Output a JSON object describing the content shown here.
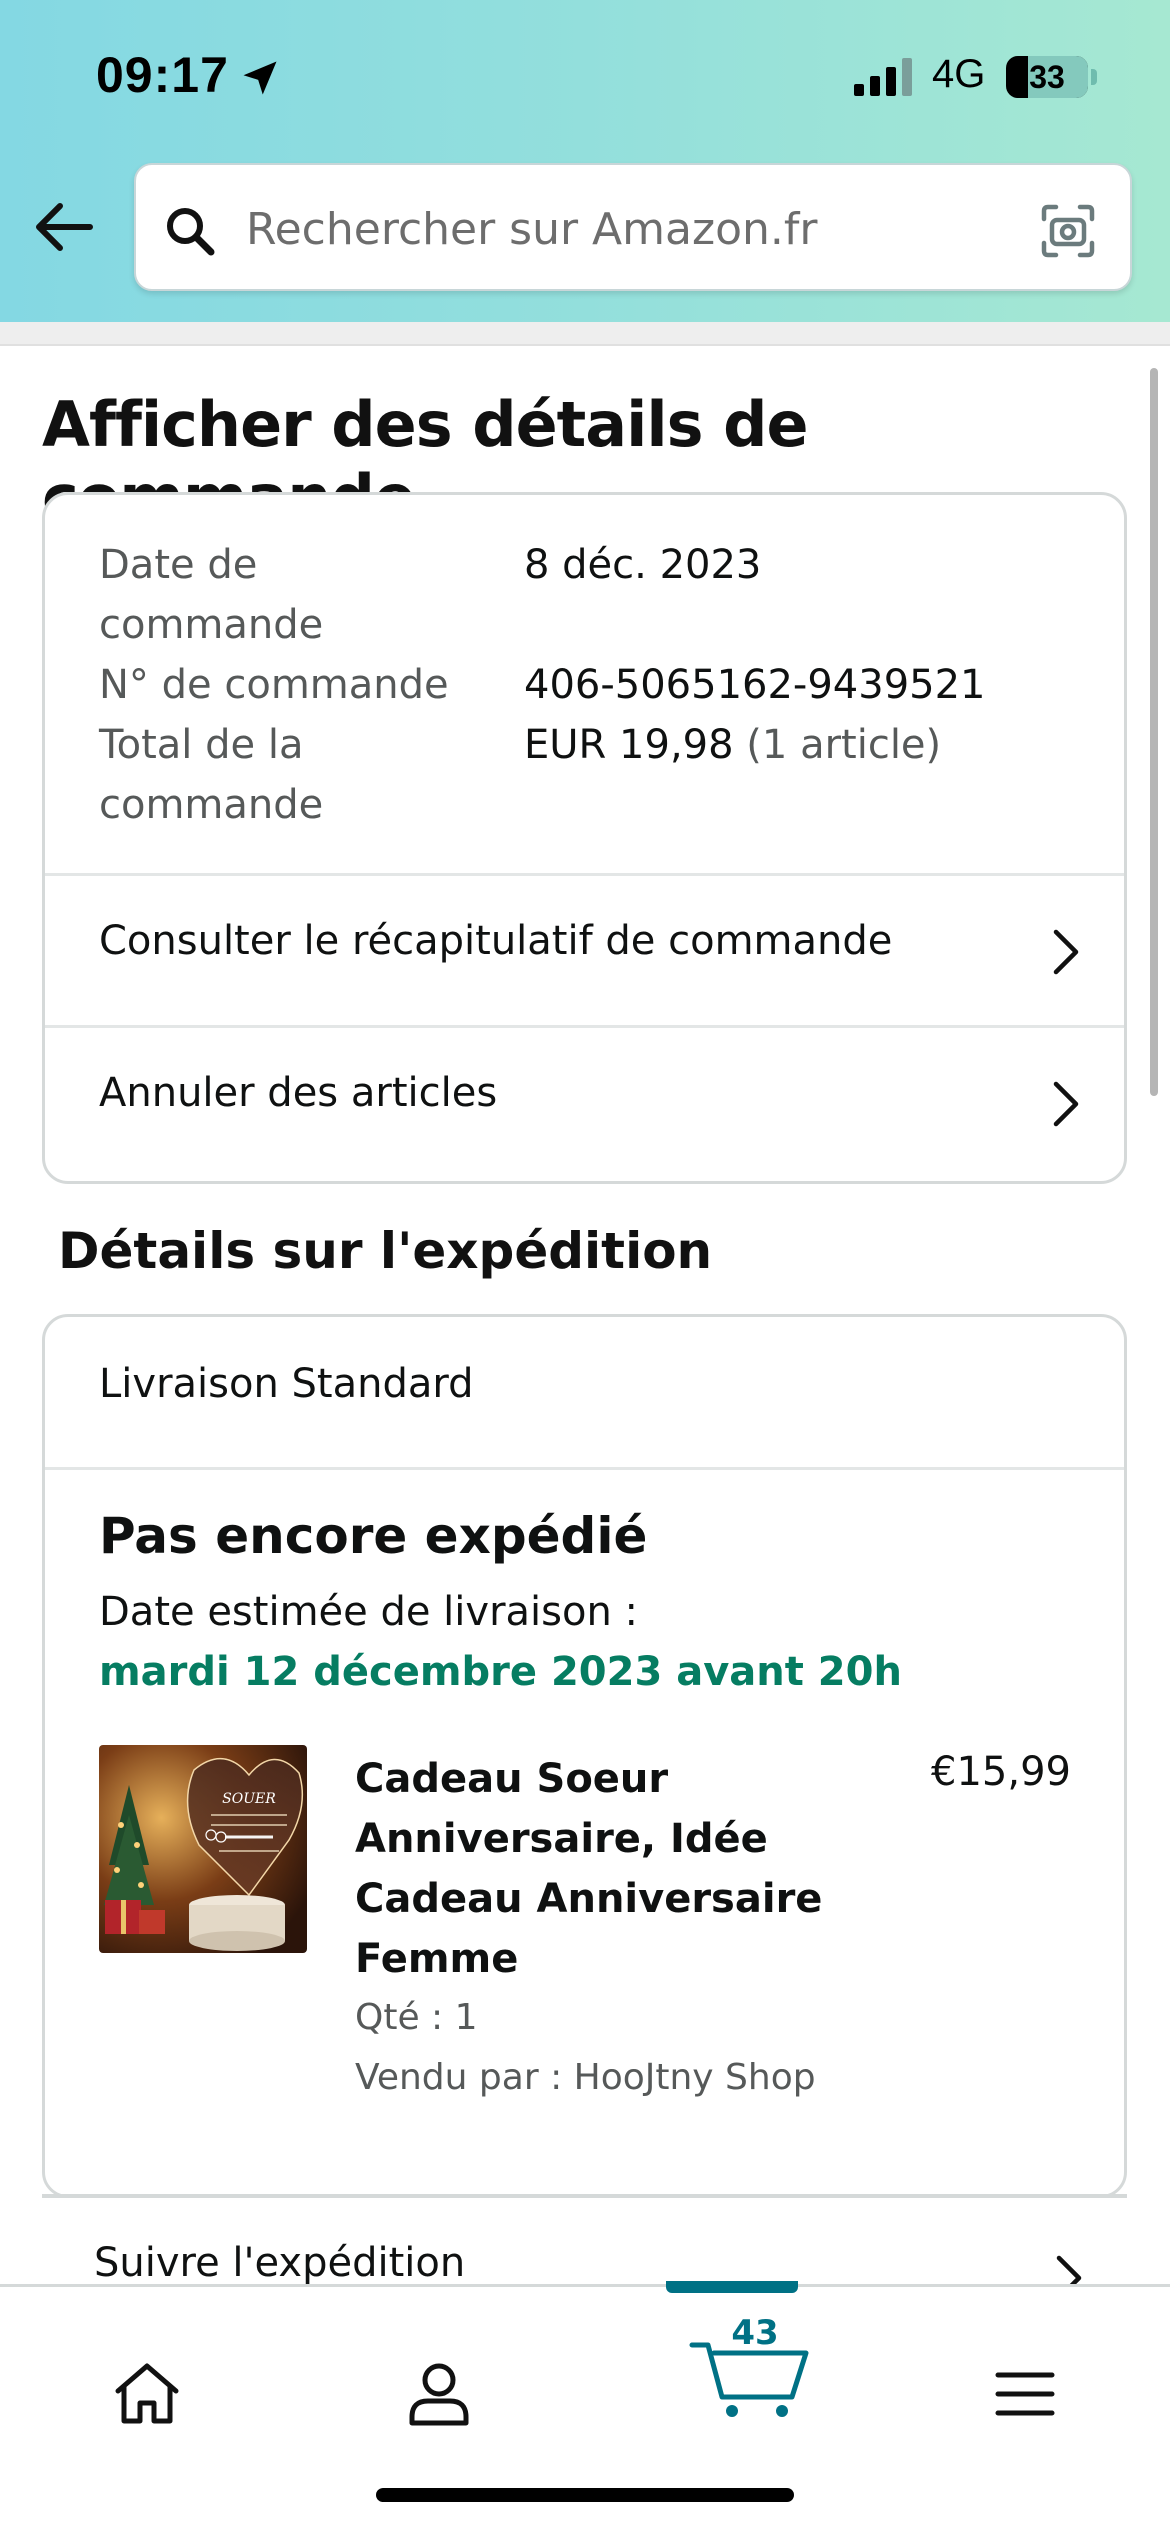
{
  "status_bar": {
    "time": "09:17",
    "network": "4G",
    "battery": "33"
  },
  "search": {
    "placeholder": "Rechercher sur Amazon.fr"
  },
  "page": {
    "title": "Afficher des détails de commande"
  },
  "order_summary": {
    "date_label": "Date de commande",
    "date_value": "8 déc. 2023",
    "number_label": "N° de commande",
    "number_value": "406-5065162-9439521",
    "total_label": "Total de la commande",
    "total_value": "EUR 19,98",
    "total_items": "(1 article)",
    "recap_link": "Consulter le récapitulatif de commande",
    "cancel_link": "Annuler des articles"
  },
  "shipment": {
    "section_title": "Détails sur l'expédition",
    "method": "Livraison Standard",
    "status": "Pas encore expédié",
    "estimate_label": "Date estimée de livraison :",
    "estimate_date": "mardi 12 décembre 2023 avant 20h",
    "track_link": "Suivre l'expédition"
  },
  "product": {
    "title": "Cadeau Soeur Anniversaire, Idée Cadeau Anniversaire Femme",
    "price": "€15,99",
    "quantity": "Qté : 1",
    "seller": "Vendu par : HooJtny Shop",
    "image_text": "SOUER"
  },
  "tabbar": {
    "cart_count": "43",
    "tabs": [
      "home-icon",
      "account-icon",
      "cart-icon",
      "menu-icon"
    ]
  },
  "colors": {
    "accent_teal": "#007185",
    "delivery_green": "#067D62",
    "header_gradient_start": "#84d8e3",
    "header_gradient_end": "#a6e8d2"
  }
}
